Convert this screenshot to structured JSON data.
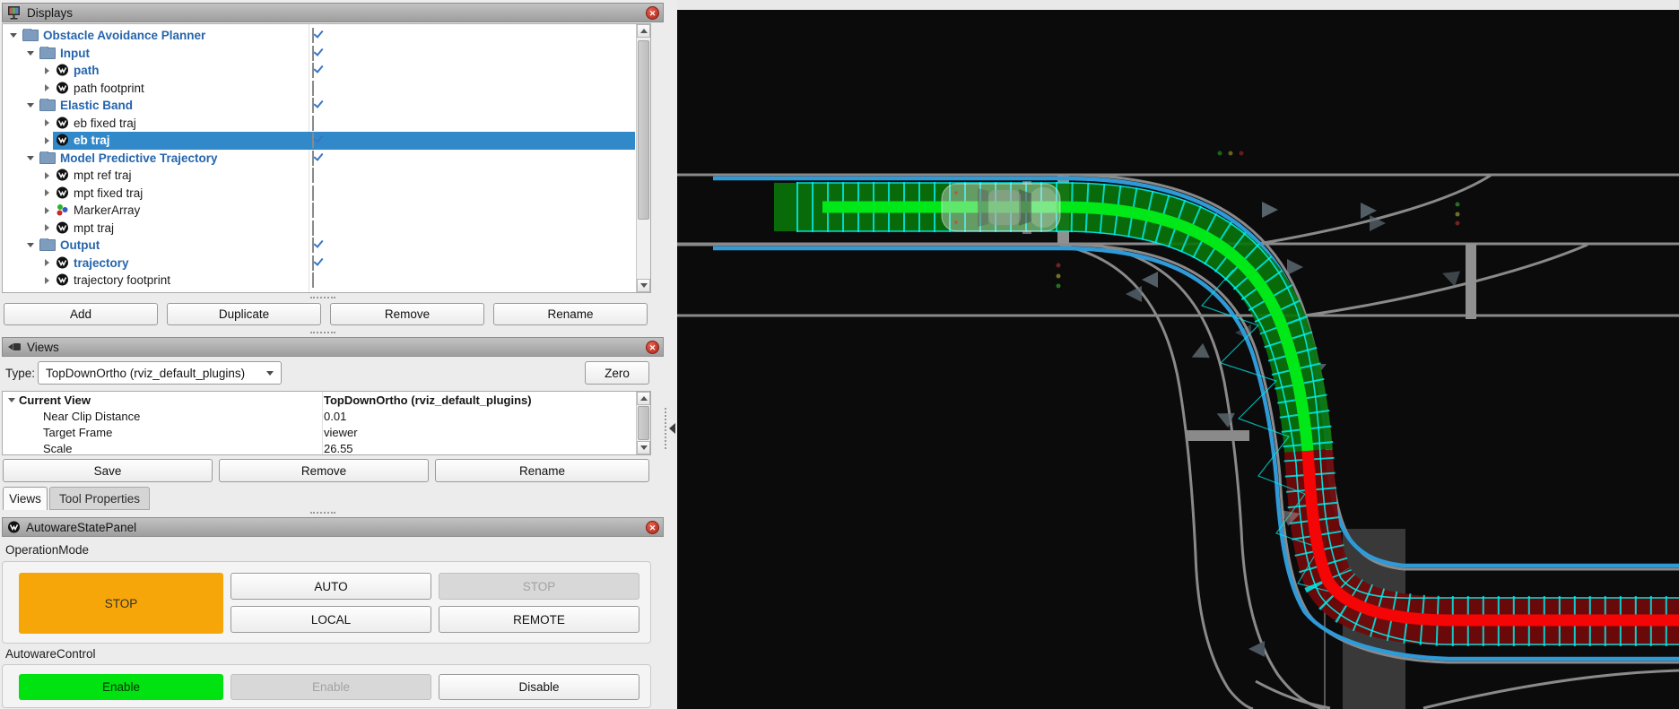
{
  "displays_panel": {
    "title": "Displays",
    "tree": {
      "items": [
        {
          "label": "Obstacle Avoidance Planner",
          "level": 0,
          "icon": "folder",
          "expanded": true,
          "checked": true,
          "selected": false
        },
        {
          "label": "Input",
          "level": 1,
          "icon": "folder",
          "expanded": true,
          "checked": true,
          "selected": false
        },
        {
          "label": "path",
          "level": 2,
          "icon": "autoware",
          "expanded": false,
          "checked": true,
          "selected": false
        },
        {
          "label": "path footprint",
          "level": 2,
          "icon": "autoware",
          "expanded": false,
          "checked": false,
          "selected": false
        },
        {
          "label": "Elastic Band",
          "level": 1,
          "icon": "folder",
          "expanded": true,
          "checked": true,
          "selected": false
        },
        {
          "label": "eb fixed traj",
          "level": 2,
          "icon": "autoware",
          "expanded": false,
          "checked": false,
          "selected": false
        },
        {
          "label": "eb traj",
          "level": 2,
          "icon": "autoware",
          "expanded": false,
          "checked": true,
          "selected": true
        },
        {
          "label": "Model Predictive Trajectory",
          "level": 1,
          "icon": "folder",
          "expanded": true,
          "checked": true,
          "selected": false
        },
        {
          "label": "mpt ref traj",
          "level": 2,
          "icon": "autoware",
          "expanded": false,
          "checked": false,
          "selected": false
        },
        {
          "label": "mpt fixed traj",
          "level": 2,
          "icon": "autoware",
          "expanded": false,
          "checked": false,
          "selected": false
        },
        {
          "label": "MarkerArray",
          "level": 2,
          "icon": "marker-array",
          "expanded": false,
          "checked": false,
          "selected": false
        },
        {
          "label": "mpt traj",
          "level": 2,
          "icon": "autoware",
          "expanded": false,
          "checked": false,
          "selected": false
        },
        {
          "label": "Output",
          "level": 1,
          "icon": "folder",
          "expanded": true,
          "checked": true,
          "selected": false
        },
        {
          "label": "trajectory",
          "level": 2,
          "icon": "autoware",
          "expanded": false,
          "checked": true,
          "selected": false
        },
        {
          "label": "trajectory footprint",
          "level": 2,
          "icon": "autoware",
          "expanded": false,
          "checked": false,
          "selected": false
        }
      ]
    },
    "buttons": [
      "Add",
      "Duplicate",
      "Remove",
      "Rename"
    ]
  },
  "views_panel": {
    "title": "Views",
    "type_label": "Type:",
    "type_value": "TopDownOrtho (rviz_default_plugins)",
    "zero_button": "Zero",
    "properties": [
      {
        "name": "Current View",
        "value": "TopDownOrtho (rviz_default_plugins)"
      },
      {
        "name": "Near Clip Distance",
        "value": "0.01"
      },
      {
        "name": "Target Frame",
        "value": "viewer"
      },
      {
        "name": "Scale",
        "value": "26.55"
      }
    ],
    "buttons": [
      "Save",
      "Remove",
      "Rename"
    ],
    "tabs": [
      {
        "label": "Views",
        "active": true
      },
      {
        "label": "Tool Properties",
        "active": false
      }
    ]
  },
  "autoware_panel": {
    "title": "AutowareStatePanel",
    "operation_mode": {
      "label": "OperationMode",
      "stop_active": "STOP",
      "auto": "AUTO",
      "stop_disabled": "STOP",
      "local": "LOCAL",
      "remote": "REMOTE"
    },
    "autoware_control": {
      "label": "AutowareControl",
      "enable_active": "Enable",
      "enable_disabled": "Enable",
      "disable": "Disable"
    },
    "colors": {
      "active_orange": "#f7a60a",
      "active_green": "#00e310"
    }
  },
  "viewport": {
    "scene": "top-down intersection with ego vehicle, planned path turning right-down then right",
    "colors": {
      "background": "#0b0b0b",
      "lane_line_gray": "#8a8a8a",
      "boundary_blue": "#2e9ad8",
      "path_band_green": "#0a730a",
      "trajectory_green": "#00e818",
      "path_band_red": "#700a0a",
      "trajectory_red": "#f50505",
      "footprint_cyan": "#00e8e8",
      "direction_arrow_gray": "#5f6d75"
    },
    "ui_colors": {
      "selection_blue": "#3289ca",
      "tree_item_blue": "#2565ad"
    }
  }
}
